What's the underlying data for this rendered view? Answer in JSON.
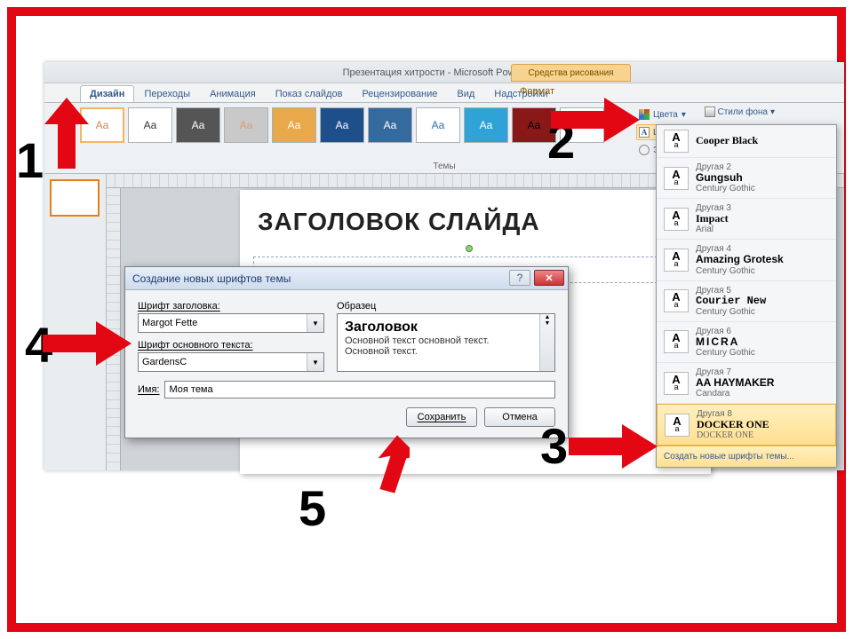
{
  "window": {
    "title": "Презентация хитрости - Microsoft PowerPoint",
    "context_group": "Средства рисования",
    "context_tab": "Формат"
  },
  "tabs": [
    "Дизайн",
    "Переходы",
    "Анимация",
    "Показ слайдов",
    "Рецензирование",
    "Вид",
    "Надстройки"
  ],
  "ribbon": {
    "themes_label": "Темы",
    "colors": "Цвета",
    "fonts": "Шрифты",
    "effects": "Эффекты",
    "styles": "Стили фона"
  },
  "slide": {
    "title": "ЗАГОЛОВОК СЛАЙДА"
  },
  "fonts_panel": {
    "items": [
      {
        "label": "",
        "name": "Cooper Black",
        "sub": ""
      },
      {
        "label": "Другая 2",
        "name": "Gungsuh",
        "sub": "Century Gothic"
      },
      {
        "label": "Другая 3",
        "name": "Impact",
        "sub": "Arial"
      },
      {
        "label": "Другая 4",
        "name": "Amazing Grotesk",
        "sub": "Century Gothic"
      },
      {
        "label": "Другая 5",
        "name": "Courier New",
        "sub": "Century Gothic"
      },
      {
        "label": "Другая 6",
        "name": "MICRA",
        "sub": "Century Gothic"
      },
      {
        "label": "Другая 7",
        "name": "AA HAYMAKER",
        "sub": "Candara"
      },
      {
        "label": "Другая 8",
        "name": "DOCKER ONE",
        "sub": "DOCKER ONE"
      }
    ],
    "footer": "Создать новые шрифты темы..."
  },
  "dialog": {
    "title": "Создание новых шрифтов темы",
    "heading_font_label": "Шрифт заголовка:",
    "heading_font": "Margot Fette",
    "body_font_label": "Шрифт основного текста:",
    "body_font": "GardensC",
    "preview_label": "Образец",
    "preview_title": "Заголовок",
    "preview_body1": "Основной текст основной текст.",
    "preview_body2": "Основной текст.",
    "name_label": "Имя:",
    "name_value": "Моя тема",
    "save": "Сохранить",
    "cancel": "Отмена"
  },
  "annotations": {
    "n1": "1",
    "n2": "2",
    "n3": "3",
    "n4": "4",
    "n5": "5"
  }
}
